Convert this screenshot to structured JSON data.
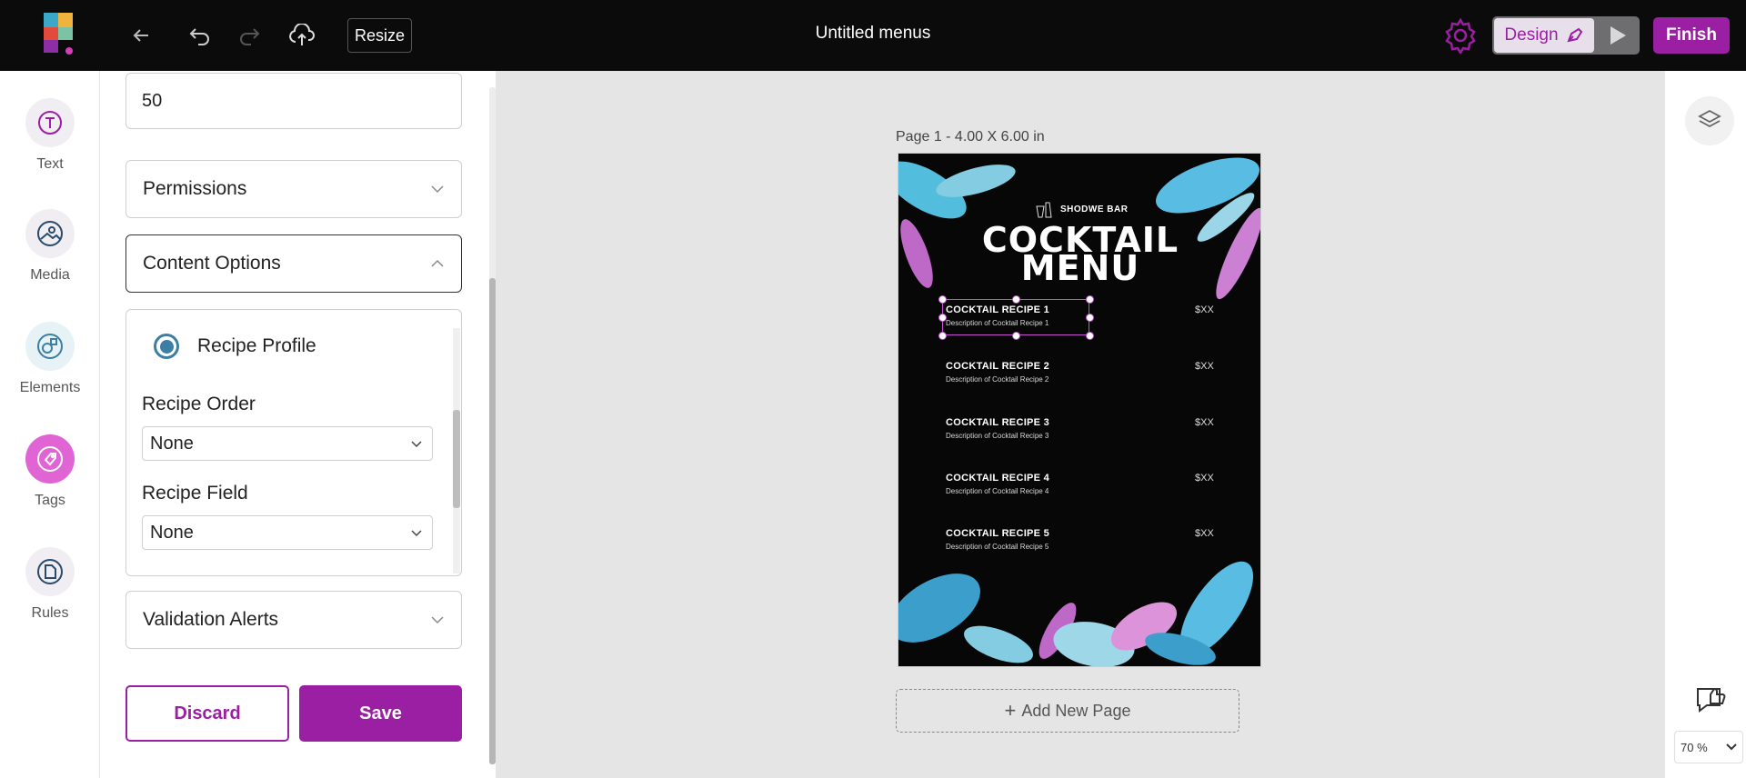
{
  "topbar": {
    "resize_label": "Resize",
    "title": "Untitled menus",
    "design_label": "Design",
    "finish_label": "Finish"
  },
  "rail": {
    "items": [
      {
        "label": "Text",
        "icon": "text-icon"
      },
      {
        "label": "Media",
        "icon": "media-icon"
      },
      {
        "label": "Elements",
        "icon": "elements-icon"
      },
      {
        "label": "Tags",
        "icon": "tag-icon"
      },
      {
        "label": "Rules",
        "icon": "rules-icon"
      }
    ]
  },
  "panel": {
    "number_value": "50",
    "permissions_label": "Permissions",
    "content_options_label": "Content Options",
    "recipe_profile_label": "Recipe Profile",
    "recipe_order_label": "Recipe Order",
    "recipe_order_value": "None",
    "recipe_field_label": "Recipe Field",
    "recipe_field_value": "None",
    "validation_label": "Validation Alerts",
    "discard_label": "Discard",
    "save_label": "Save"
  },
  "canvas": {
    "page_label": "Page 1 - 4.00 X 6.00 in",
    "bar_name": "SHODWE BAR",
    "menu_title_1": "COCKTAIL",
    "menu_title_2": "MENU",
    "recipes": [
      {
        "name": "COCKTAIL RECIPE 1",
        "desc": "Description of Cocktail Recipe 1",
        "price": "$XX"
      },
      {
        "name": "COCKTAIL RECIPE 2",
        "desc": "Description of Cocktail Recipe 2",
        "price": "$XX"
      },
      {
        "name": "COCKTAIL RECIPE 3",
        "desc": "Description of Cocktail Recipe 3",
        "price": "$XX"
      },
      {
        "name": "COCKTAIL RECIPE 4",
        "desc": "Description of Cocktail Recipe 4",
        "price": "$XX"
      },
      {
        "name": "COCKTAIL RECIPE 5",
        "desc": "Description of Cocktail Recipe 5",
        "price": "$XX"
      }
    ],
    "add_page_label": "Add New Page"
  },
  "zoom": {
    "value": "70 %"
  },
  "colors": {
    "accent": "#9b1fa3",
    "radio": "#3d7fa4",
    "canvas_bg": "#e5e5e5"
  }
}
